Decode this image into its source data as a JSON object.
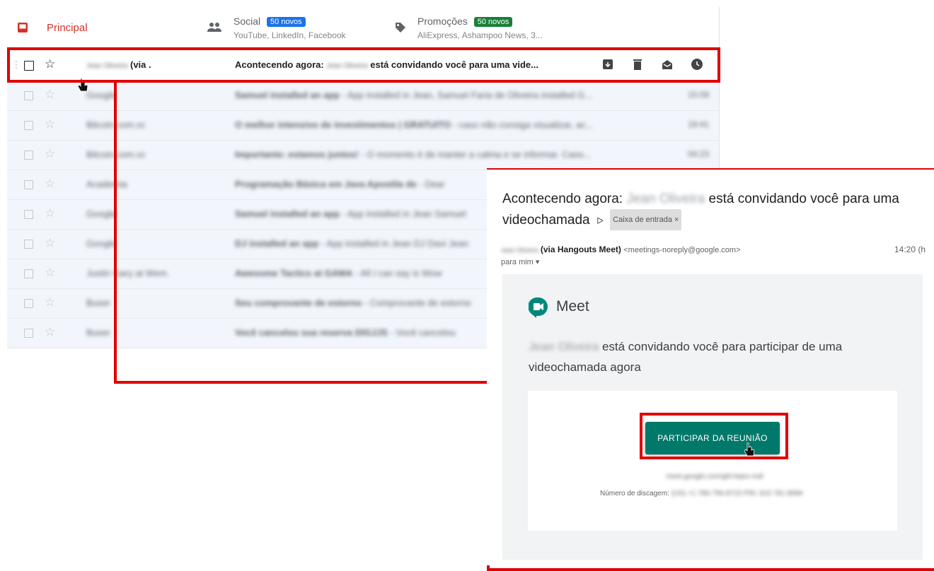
{
  "tabs": {
    "principal": {
      "label": "Principal",
      "icon": "inbox-icon"
    },
    "social": {
      "label": "Social",
      "badge": "50 novos",
      "subtitle": "YouTube, LinkedIn, Facebook",
      "icon": "people-icon"
    },
    "promo": {
      "label": "Promoções",
      "badge": "50 novos",
      "subtitle": "AliExpress, Ashampoo News, 3...",
      "icon": "tag-icon"
    }
  },
  "selected_row": {
    "sender_blurred": "Jean Oliveira",
    "sender_suffix": "(via .",
    "subject_prefix": "Acontecendo agora:",
    "subject_blurred": "Jean Oliveira",
    "subject_suffix": "está convidando você para uma vide...",
    "actions": [
      "archive-icon",
      "trash-icon",
      "mark-read-icon",
      "snooze-icon"
    ]
  },
  "rows": [
    {
      "sender": "Google",
      "subject": "Samuel installed an app",
      "snippet": "- App installed in Jean, Samuel Faria de Oliveira installed G...",
      "time": "15:09"
    },
    {
      "sender": "Bitcoin.com.vc",
      "subject": "O melhor intensivo de investimentos | GRATUITO",
      "snippet": "- caso não consiga visualizar, ac...",
      "time": "19:41"
    },
    {
      "sender": "Bitcoin.com.vc",
      "subject": "Importante: estamos juntos!",
      "snippet": "- O momento é de manter a calma e se informar. Caso...",
      "time": "04:23"
    },
    {
      "sender": "Academia",
      "subject": "Programação Básica em Java Apostila de",
      "snippet": "- Dear",
      "time": ""
    },
    {
      "sender": "Google",
      "subject": "Samuel installed an app",
      "snippet": "- App installed in Jean Samuel",
      "time": ""
    },
    {
      "sender": "Google",
      "subject": "DJ installed an app",
      "snippet": "- App installed in Jean DJ Davi Jean",
      "time": ""
    },
    {
      "sender": "Justin Gary at Wem.",
      "subject": "Awesome Tactics at GAMA",
      "snippet": "- All I can say is Wow",
      "time": ""
    },
    {
      "sender": "Buser",
      "subject": "Seu comprovante de estorno",
      "snippet": "- Comprovante de estorno",
      "time": ""
    },
    {
      "sender": "Buser",
      "subject": "Você cancelou sua reserva DIGJJS",
      "snippet": "- Você cancelou",
      "time": ""
    }
  ],
  "email": {
    "subject_prefix": "Acontecendo agora:",
    "subject_blurred": "Jean Oliveira",
    "subject_suffix": "está convidando você para uma videochamada",
    "important_marker": "ᐅ",
    "label": "Caixa de entrada ×",
    "from_blurred": "Jean Oliveira",
    "from_via": "(via Hangouts Meet)",
    "from_address": "<meetings-noreply@google.com>",
    "time": "14:20 (h",
    "to": "para mim ▾",
    "meet_title": "Meet",
    "invite_blurred": "Jean Oliveira",
    "invite_text": "está convidando você para participar de uma videochamada agora",
    "join_button": "PARTICIPAR DA REUNIÃO",
    "meet_link_blurred": "meet.google.com/ght-kqes-mdi",
    "dial_label": "Número de discagem:",
    "dial_blurred": "(US) +1 786-756-8715 PIN: 810 781 808#"
  },
  "colors": {
    "highlight": "#e00000",
    "meet_button": "#00796b",
    "badge_social": "#1a73e8",
    "badge_promo": "#188038",
    "principal": "#d93025"
  }
}
